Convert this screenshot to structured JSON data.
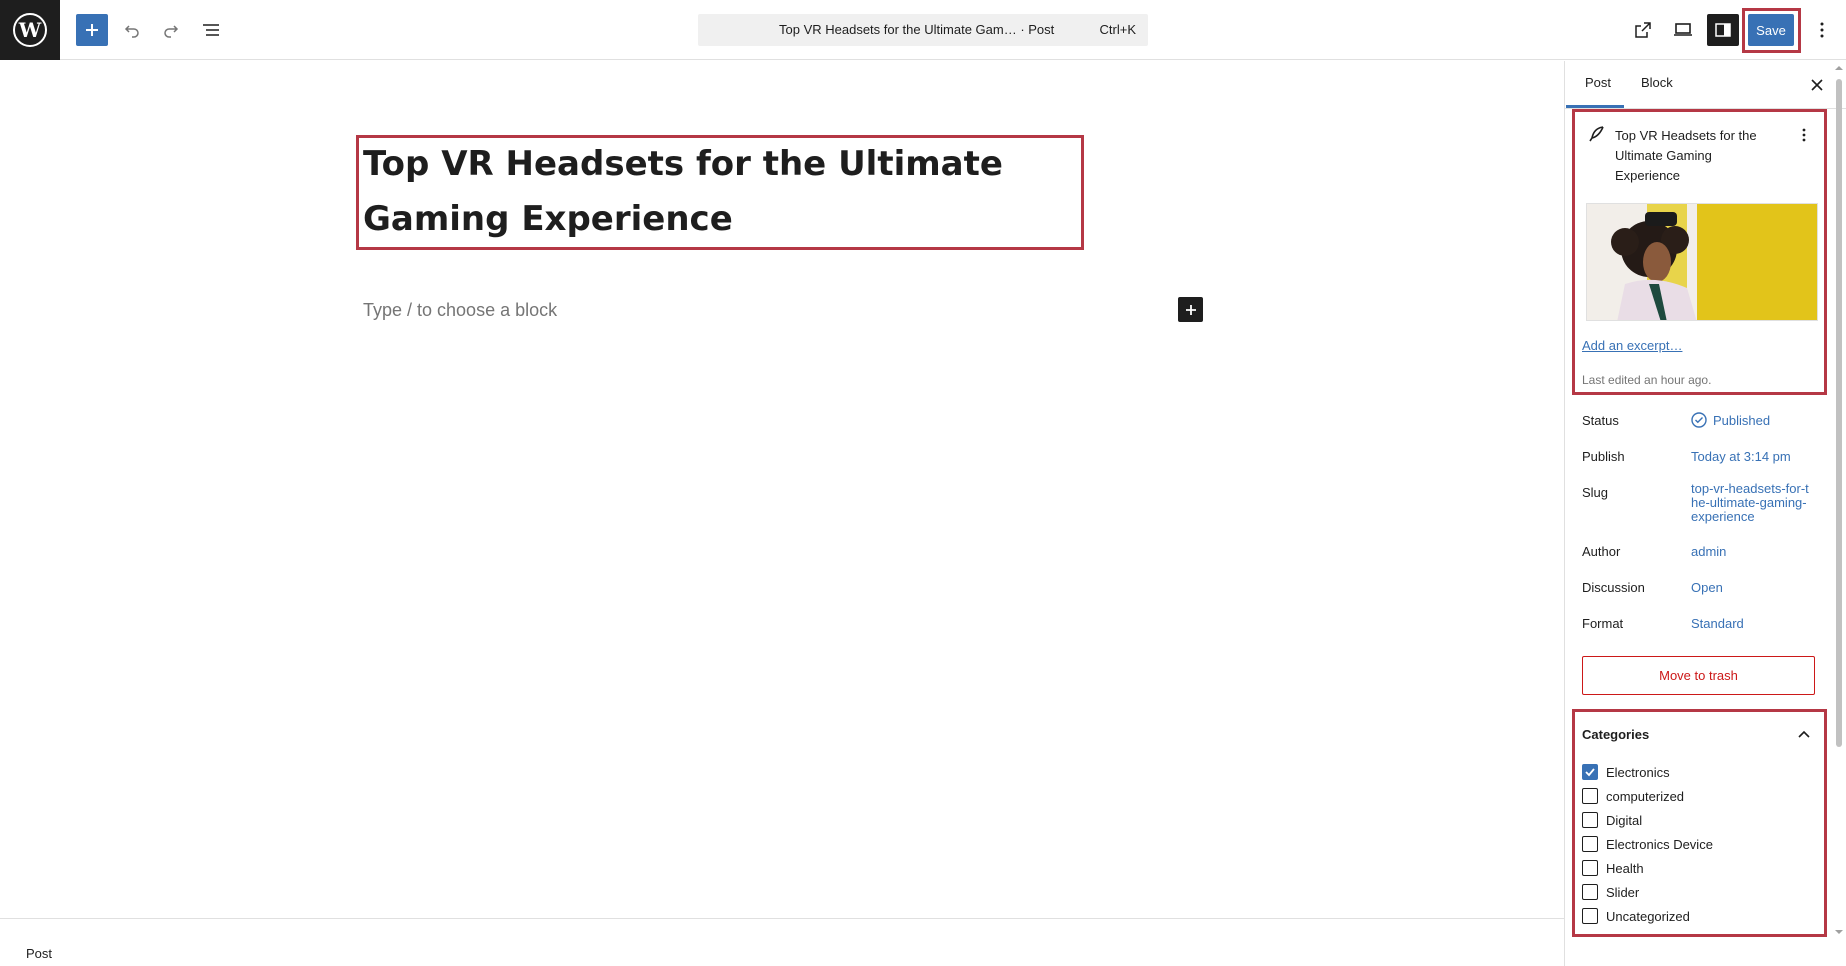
{
  "header": {
    "command_bar": {
      "title": "Top VR Headsets for the Ultimate Gam… · Post",
      "shortcut": "Ctrl+K"
    },
    "save_label": "Save"
  },
  "editor": {
    "title": "Top VR Headsets for the Ultimate Gaming Experience",
    "block_placeholder": "Type / to choose a block"
  },
  "footer": {
    "breadcrumb": "Post"
  },
  "sidebar": {
    "tabs": [
      "Post",
      "Block"
    ],
    "active_tab": "Post",
    "post_summary": {
      "title": "Top VR Headsets for the Ultimate Gaming Experience",
      "excerpt_link": "Add an excerpt…",
      "last_edited": "Last edited an hour ago."
    },
    "meta": {
      "status": {
        "label": "Status",
        "value": "Published"
      },
      "publish": {
        "label": "Publish",
        "value": "Today at 3:14 pm"
      },
      "slug": {
        "label": "Slug",
        "value": "top-vr-headsets-for-the-ultimate-gaming-experience"
      },
      "author": {
        "label": "Author",
        "value": "admin"
      },
      "discussion": {
        "label": "Discussion",
        "value": "Open"
      },
      "format": {
        "label": "Format",
        "value": "Standard"
      }
    },
    "trash_label": "Move to trash",
    "categories": {
      "heading": "Categories",
      "items": [
        {
          "label": "Electronics",
          "checked": true
        },
        {
          "label": "computerized",
          "checked": false
        },
        {
          "label": "Digital",
          "checked": false
        },
        {
          "label": "Electronics Device",
          "checked": false
        },
        {
          "label": "Health",
          "checked": false
        },
        {
          "label": "Slider",
          "checked": false
        },
        {
          "label": "Uncategorized",
          "checked": false
        }
      ]
    }
  },
  "colors": {
    "accent": "#3871b5",
    "highlight_border": "#b53845",
    "danger": "#cc1818"
  }
}
